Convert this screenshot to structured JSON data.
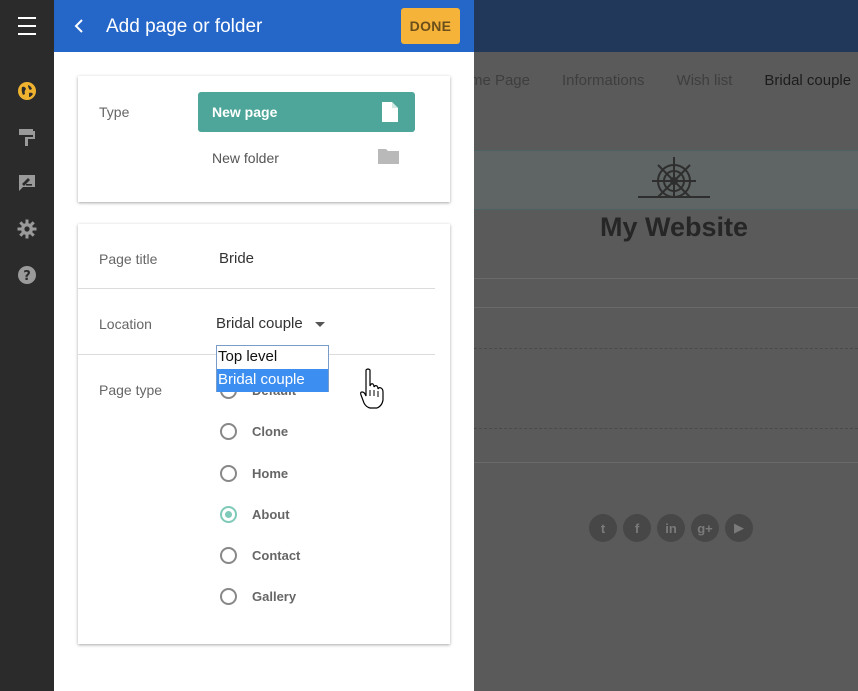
{
  "panel": {
    "title": "Add page or folder",
    "done_label": "DONE"
  },
  "rail": {
    "icons": [
      "menu-icon",
      "globe-icon",
      "paint-roller-icon",
      "feedback-icon",
      "gear-icon",
      "help-icon"
    ]
  },
  "type_card": {
    "label": "Type",
    "new_page_label": "New page",
    "new_folder_label": "New folder"
  },
  "form": {
    "page_title_label": "Page title",
    "page_title_value": "Bride",
    "location_label": "Location",
    "location_value": "Bridal couple",
    "location_options": [
      "Top level",
      "Bridal couple"
    ],
    "page_type_label": "Page type",
    "page_types": [
      "Default",
      "Clone",
      "Home",
      "About",
      "Contact",
      "Gallery"
    ],
    "selected_page_type": "About"
  },
  "site_preview": {
    "nav": [
      "Home Page",
      "Informations",
      "Wish list",
      "Bridal couple"
    ],
    "title": "My Website",
    "social_icons": [
      "twitter-icon",
      "facebook-icon",
      "linkedin-icon",
      "google-plus-icon",
      "youtube-icon"
    ]
  },
  "colors": {
    "header_blue": "#2567c9",
    "done_orange": "#f6b33a",
    "teal": "#4da699",
    "rail": "#2b2b2b",
    "accent_yellow": "#f0b330"
  }
}
